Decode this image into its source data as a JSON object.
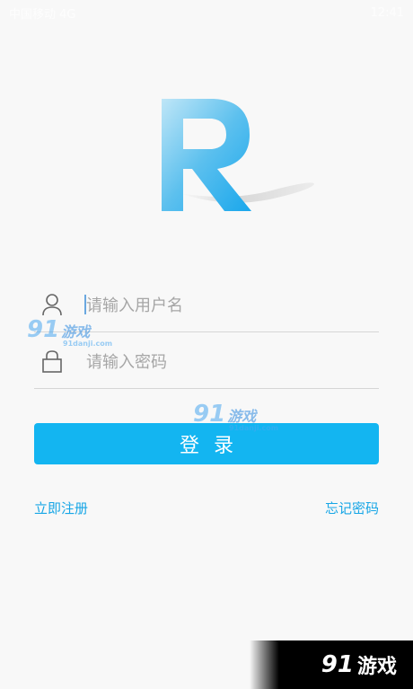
{
  "status_bar": {
    "left_text": "中国移动 4G",
    "right_text": "12:41"
  },
  "login_form": {
    "username_placeholder": "请输入用户名",
    "password_placeholder": "请输入密码",
    "login_label": "登录",
    "register_label": "立即注册",
    "forgot_label": "忘记密码"
  },
  "watermark": {
    "number": "91",
    "text": "游戏",
    "site": "91danji.com"
  },
  "colors": {
    "accent": "#13b5f1",
    "link": "#17a6e6",
    "background": "#f8f8f8"
  },
  "icons": {
    "logo": "r-logo-icon",
    "user": "user-icon",
    "lock": "lock-icon"
  }
}
